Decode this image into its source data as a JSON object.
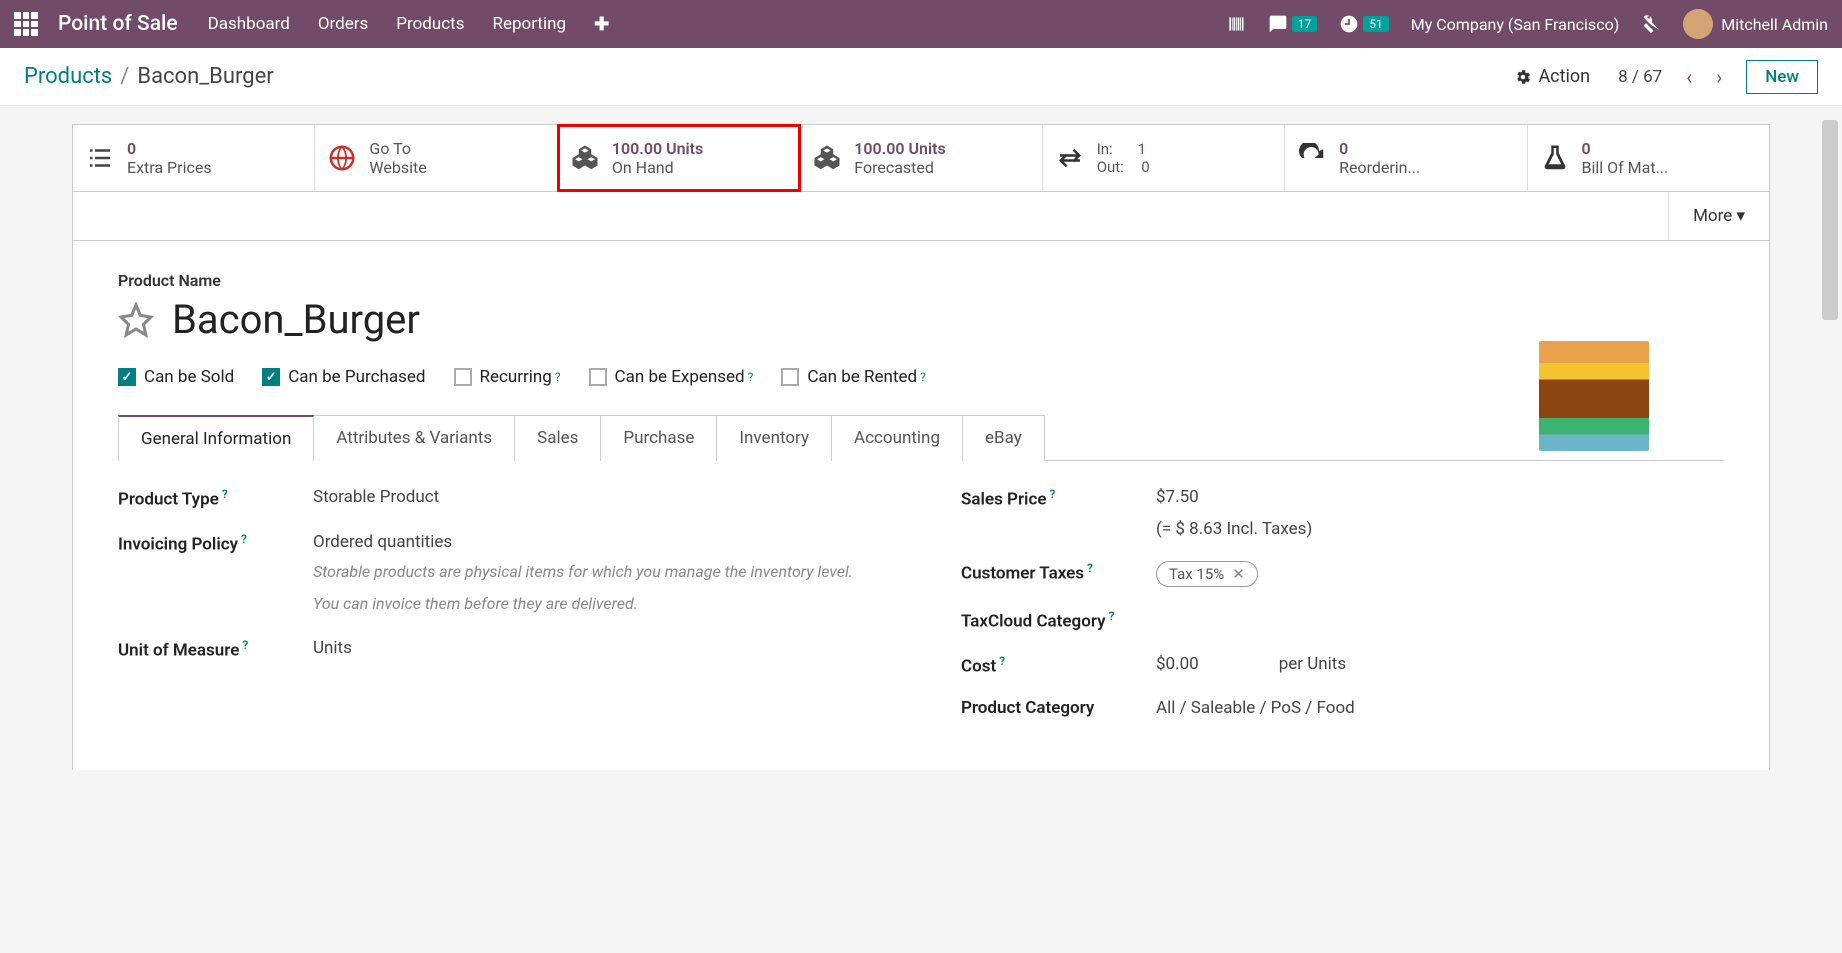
{
  "topbar": {
    "brand": "Point of Sale",
    "nav": [
      "Dashboard",
      "Orders",
      "Products",
      "Reporting"
    ],
    "company": "My Company (San Francisco)",
    "user": "Mitchell Admin",
    "msg_badge": "17",
    "activity_badge": "51"
  },
  "breadcrumb": {
    "parent": "Products",
    "current": "Bacon_Burger",
    "action": "Action",
    "pager": "8 / 67",
    "new": "New"
  },
  "smart": {
    "extra_prices": {
      "count": "0",
      "label": "Extra Prices"
    },
    "website": {
      "line1": "Go To",
      "line2": "Website"
    },
    "onhand": {
      "qty": "100.00 Units",
      "label": "On Hand"
    },
    "forecasted": {
      "qty": "100.00 Units",
      "label": "Forecasted"
    },
    "inout": {
      "in_label": "In:",
      "in_val": "1",
      "out_label": "Out:",
      "out_val": "0"
    },
    "reorder": {
      "count": "0",
      "label": "Reorderin..."
    },
    "bom": {
      "count": "0",
      "label": "Bill Of Mat..."
    },
    "more": "More"
  },
  "product": {
    "label": "Product Name",
    "name": "Bacon_Burger",
    "checks": {
      "can_sold": "Can be Sold",
      "can_purchased": "Can be Purchased",
      "recurring": "Recurring",
      "can_expensed": "Can be Expensed",
      "can_rented": "Can be Rented"
    }
  },
  "tabs": [
    "General Information",
    "Attributes & Variants",
    "Sales",
    "Purchase",
    "Inventory",
    "Accounting",
    "eBay"
  ],
  "fields": {
    "left": {
      "product_type": {
        "label": "Product Type",
        "value": "Storable Product"
      },
      "invoicing": {
        "label": "Invoicing Policy",
        "value": "Ordered quantities",
        "help1": "Storable products are physical items for which you manage the inventory level.",
        "help2": "You can invoice them before they are delivered."
      },
      "uom": {
        "label": "Unit of Measure",
        "value": "Units"
      }
    },
    "right": {
      "sales_price": {
        "label": "Sales Price",
        "value": "$7.50",
        "incl": "(= $ 8.63 Incl. Taxes)"
      },
      "customer_taxes": {
        "label": "Customer Taxes",
        "tag": "Tax 15%"
      },
      "taxcloud": {
        "label": "TaxCloud Category"
      },
      "cost": {
        "label": "Cost",
        "value": "$0.00",
        "per": "per Units"
      },
      "category": {
        "label": "Product Category",
        "value": "All / Saleable / PoS / Food"
      }
    }
  }
}
